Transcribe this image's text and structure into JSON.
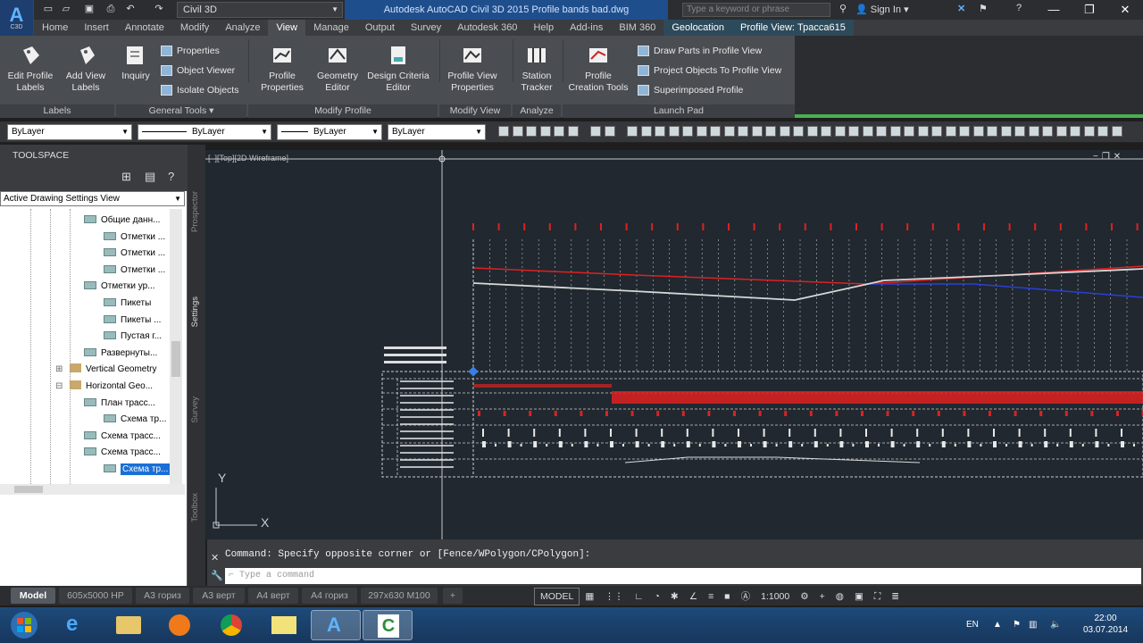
{
  "app": {
    "logo_text": "A",
    "logo_sub": "C3D",
    "workspace": "Civil 3D",
    "window_title": "Autodesk AutoCAD Civil 3D 2015    Profile bands bad.dwg",
    "search_placeholder": "Type a keyword or phrase",
    "sign_in": "Sign In"
  },
  "ribbon_tabs": [
    "Home",
    "Insert",
    "Annotate",
    "Modify",
    "Analyze",
    "View",
    "Manage",
    "Output",
    "Survey",
    "Autodesk 360",
    "Help",
    "Add-ins",
    "BIM 360",
    "Geolocation",
    "Profile View: Трасса615"
  ],
  "ribbon": {
    "edit_profile_labels": "Edit Profile\nLabels",
    "add_view_labels": "Add View\nLabels",
    "inquiry": "Inquiry",
    "properties": "Properties",
    "object_viewer": "Object Viewer",
    "isolate_objects": "Isolate Objects",
    "profile_properties": "Profile\nProperties",
    "geometry_editor": "Geometry\nEditor",
    "design_criteria_editor": "Design Criteria\nEditor",
    "profile_view_properties": "Profile View\nProperties",
    "station_tracker": "Station\nTracker",
    "profile_creation_tools": "Profile\nCreation Tools",
    "draw_parts": "Draw Parts in Profile View",
    "project_objects": "Project Objects To Profile View",
    "superimposed": "Superimposed Profile",
    "panels": {
      "labels": "Labels",
      "general_tools": "General Tools ▾",
      "modify_profile": "Modify Profile",
      "modify_view": "Modify View",
      "analyze": "Analyze",
      "launch_pad": "Launch Pad"
    }
  },
  "properties_bar": {
    "layer": "ByLayer",
    "linetype": "ByLayer",
    "lineweight": "ByLayer",
    "color": "ByLayer"
  },
  "toolspace": {
    "title": "TOOLSPACE",
    "view_select": "Active Drawing Settings View",
    "tree": [
      {
        "label": "Общие данн...",
        "indent": 94,
        "kind": "style"
      },
      {
        "label": "Отметки ...",
        "indent": 116,
        "kind": "style"
      },
      {
        "label": "Отметки ...",
        "indent": 116,
        "kind": "style"
      },
      {
        "label": "Отметки ...",
        "indent": 116,
        "kind": "style"
      },
      {
        "label": "Отметки ур...",
        "indent": 94,
        "kind": "style"
      },
      {
        "label": "Пикеты",
        "indent": 116,
        "kind": "style"
      },
      {
        "label": "Пикеты ...",
        "indent": 116,
        "kind": "style"
      },
      {
        "label": "Пустая г...",
        "indent": 116,
        "kind": "style"
      },
      {
        "label": "Развернуты...",
        "indent": 94,
        "kind": "style"
      },
      {
        "label": "Vertical Geometry",
        "indent": 78,
        "kind": "folder"
      },
      {
        "label": "Horizontal Geo...",
        "indent": 78,
        "kind": "folder"
      },
      {
        "label": "План трасс...",
        "indent": 94,
        "kind": "style"
      },
      {
        "label": "Схема тр...",
        "indent": 116,
        "kind": "style"
      },
      {
        "label": "Схема трасс...",
        "indent": 94,
        "kind": "style"
      },
      {
        "label": "Схема трасс...",
        "indent": 94,
        "kind": "style"
      },
      {
        "label": "Схема тр...",
        "indent": 116,
        "kind": "style",
        "selected": true
      }
    ],
    "side_tabs": [
      "Prospector",
      "Settings",
      "Survey",
      "Toolbox"
    ]
  },
  "viewport": {
    "label": "[–][Top][2D Wireframe]",
    "ucs_y": "Y",
    "ucs_x": "X"
  },
  "command": {
    "history": "Command: Specify opposite corner or [Fence/WPolygon/CPolygon]:",
    "placeholder": "Type a command",
    "prompt_icon": "⌐"
  },
  "layout_tabs": [
    "Model",
    "605х5000 НР",
    "А3 гориз",
    "А3 верт",
    "А4 верт",
    "А4 гориз",
    "297х630 М100",
    "+"
  ],
  "status": {
    "model": "MODEL",
    "scale": "1:1000"
  },
  "tray": {
    "lang": "EN",
    "time": "22:00",
    "date": "03.07.2014"
  },
  "colors": {
    "canvas_bg": "#212830",
    "profile_red": "#e02020",
    "profile_white": "#d8d8d8",
    "profile_blue": "#2a3fd6",
    "accent": "#1a6fd6"
  }
}
